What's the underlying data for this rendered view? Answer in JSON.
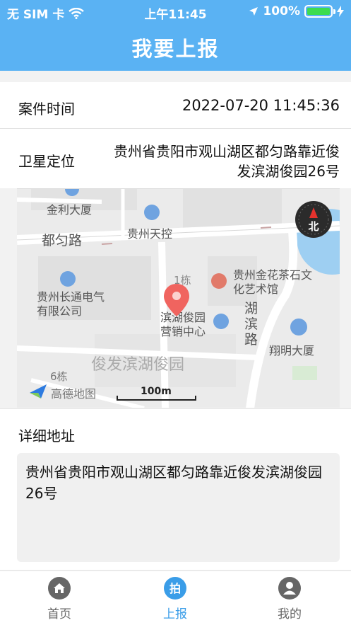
{
  "status_bar": {
    "carrier": "无 SIM 卡",
    "time": "上午11:45",
    "battery": "100%"
  },
  "header": {
    "title": "我要上报"
  },
  "case_time": {
    "label": "案件时间",
    "value": "2022-07-20 11:45:36"
  },
  "location": {
    "label": "卫星定位",
    "value": "贵州省贵阳市观山湖区都匀路靠近俊发滨湖俊园26号"
  },
  "map": {
    "labels": {
      "jinli": "金利大厦",
      "duyun_road": "都匀路",
      "tiankong": "贵州天控",
      "changtong": "贵州长通电气有限公司",
      "building1": "1栋",
      "jinhua": "贵州金花茶石文化艺术馆",
      "sales": "滨湖俊园营销中心",
      "hubin_road": "湖滨路",
      "xiangming": "翔明大厦",
      "junfa": "俊发滨湖俊园",
      "building6": "6栋",
      "amap": "高德地图",
      "scale": "100m",
      "compass": "北"
    }
  },
  "detail": {
    "label": "详细地址",
    "value": "贵州省贵阳市观山湖区都匀路靠近俊发滨湖俊园26号"
  },
  "tabs": [
    {
      "label": "首页",
      "icon": "home-icon"
    },
    {
      "label": "上报",
      "icon": "camera-report-icon"
    },
    {
      "label": "我的",
      "icon": "user-icon"
    }
  ],
  "colors": {
    "accent": "#5ab2f3",
    "active_tab": "#3a9de8",
    "pin": "#f0645f"
  }
}
